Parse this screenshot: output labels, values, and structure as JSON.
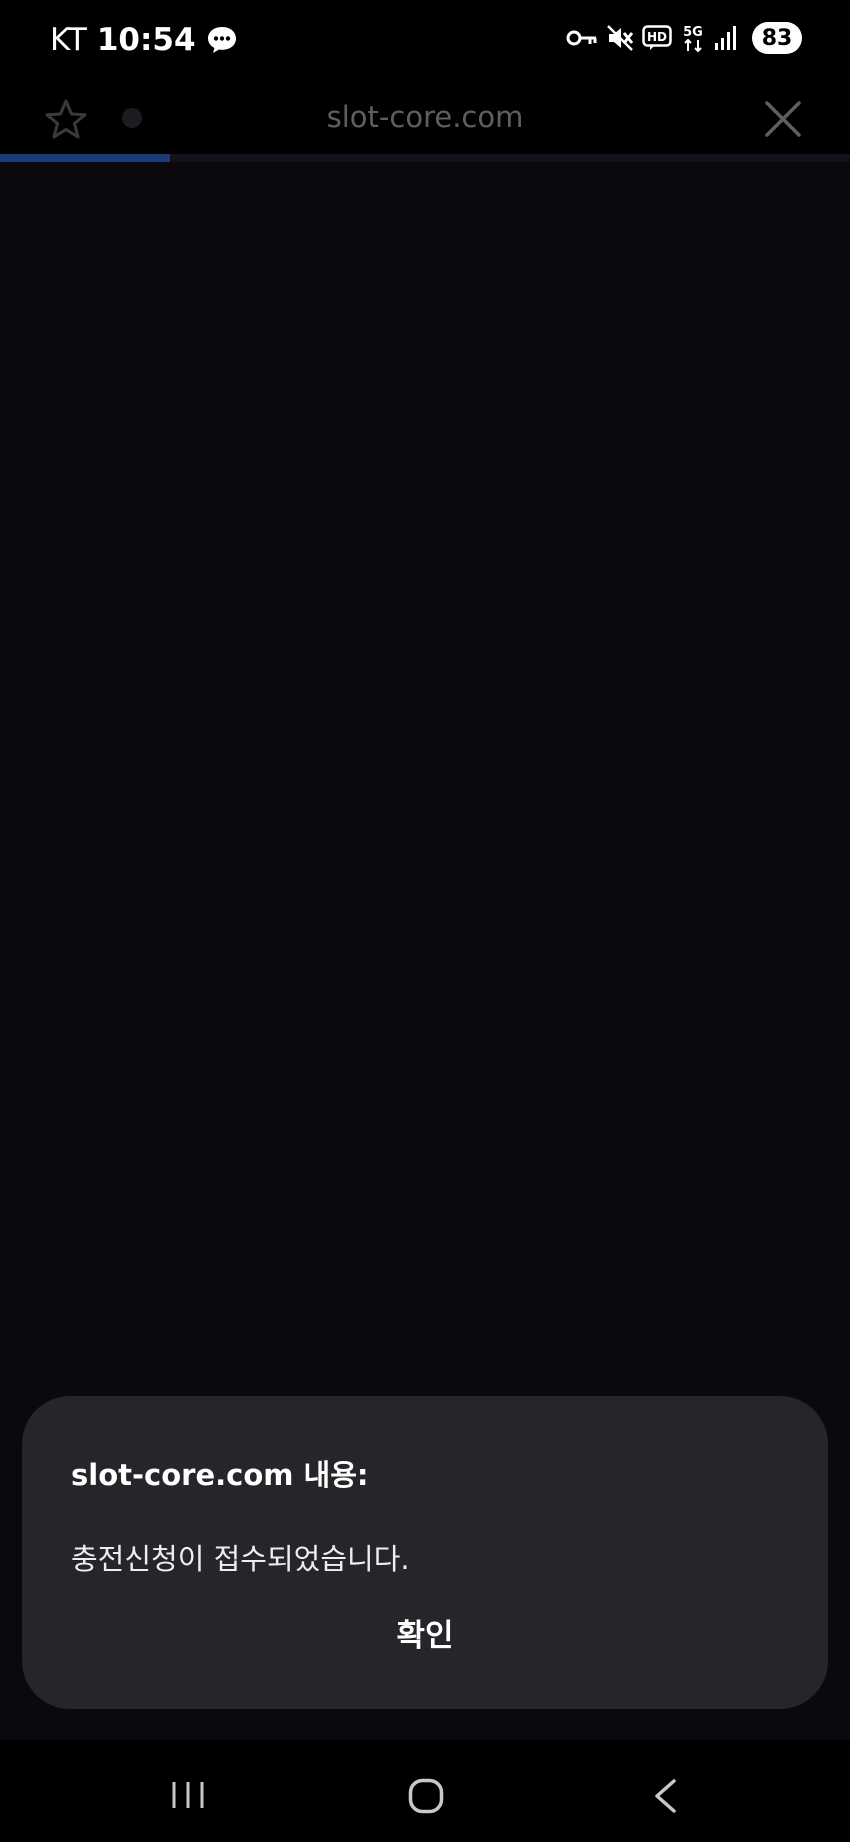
{
  "status_bar": {
    "carrier": "KT",
    "time": "10:54",
    "network": "5G",
    "battery": "83",
    "icons": [
      "message-icon",
      "vpn-key-icon",
      "mute-icon",
      "hd-voice-icon",
      "network-5g-icon",
      "signal-icon"
    ]
  },
  "browser": {
    "url": "slot-core.com",
    "progress": 0.2,
    "icons": [
      "star-icon",
      "close-icon"
    ]
  },
  "dialog": {
    "title": "slot-core.com 내용:",
    "message": "충전신청이 접수되었습니다.",
    "ok_label": "확인"
  },
  "nav_bar": {
    "icons": [
      "recents-icon",
      "home-icon",
      "back-icon"
    ]
  },
  "colors": {
    "background": "#0b090d",
    "dialog": "#262529",
    "progress": "#1a3a78",
    "url_text": "#5e5e63"
  }
}
